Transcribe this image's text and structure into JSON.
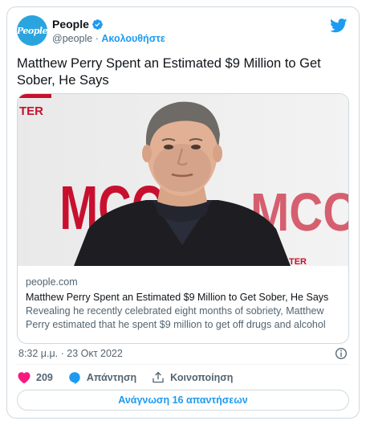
{
  "account": {
    "avatar_text": "People",
    "name": "People",
    "handle": "@people",
    "separator": "·",
    "follow_label": "Ακολουθήστε"
  },
  "tweet": {
    "text": "Matthew Perry Spent an Estimated $9 Million to Get Sober, He Says"
  },
  "link_card": {
    "domain": "people.com",
    "title": "Matthew Perry Spent an Estimated $9 Million to Get Sober, He Says",
    "description": "Revealing he recently celebrated eight months of sobriety, Matthew Perry estimated that he spent $9 million to get off drugs and alcohol",
    "backdrop_text": [
      "TER",
      "MCC",
      "MCC",
      "TER"
    ]
  },
  "meta": {
    "timestamp": "8:32 μ.μ. · 23 Οκτ 2022"
  },
  "actions": {
    "like_count": "209",
    "reply_label": "Απάντηση",
    "share_label": "Κοινοποίηση"
  },
  "footer": {
    "read_replies_label": "Ανάγνωση 16 απαντήσεων"
  },
  "colors": {
    "accent": "#1d9bf0",
    "like": "#f91880",
    "muted": "#536471",
    "border": "#cfd9de"
  },
  "icons": [
    "verified-badge-icon",
    "twitter-bird-icon",
    "info-icon",
    "heart-icon",
    "reply-bubble-icon",
    "share-icon"
  ]
}
